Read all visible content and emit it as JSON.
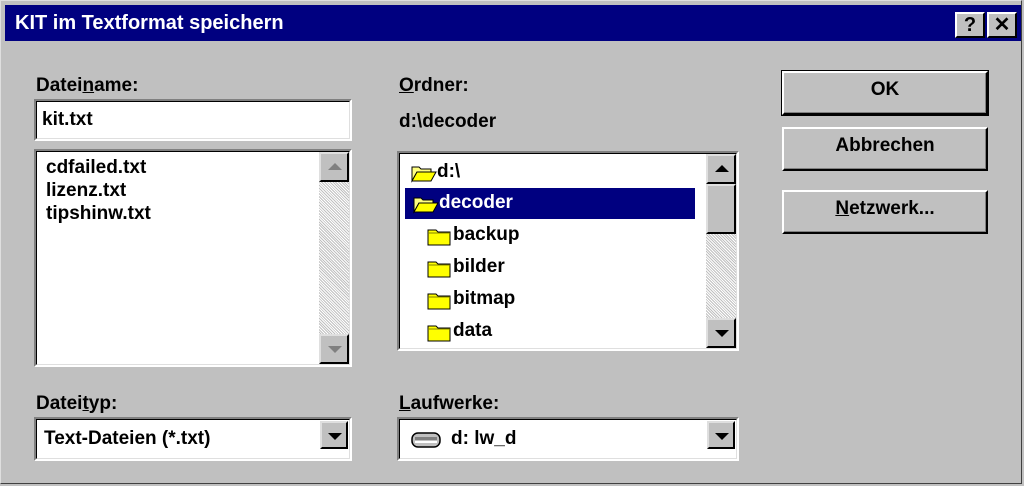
{
  "window": {
    "title": "KIT im Textformat speichern",
    "help_glyph": "?",
    "close_glyph": "✕"
  },
  "filename": {
    "label_pre": "Datei",
    "label_ul": "n",
    "label_post": "ame:",
    "value": "kit.txt",
    "files": [
      "cdfailed.txt",
      "lizenz.txt",
      "tipshinw.txt"
    ]
  },
  "folder": {
    "label_ul": "O",
    "label_post": "rdner:",
    "current_path": "d:\\decoder",
    "items": [
      {
        "name": "d:\\",
        "icon": "open-folder-icon",
        "selected": false
      },
      {
        "name": "decoder",
        "icon": "open-folder-icon",
        "selected": true
      },
      {
        "name": "backup",
        "icon": "folder-icon",
        "selected": false
      },
      {
        "name": "bilder",
        "icon": "folder-icon",
        "selected": false
      },
      {
        "name": "bitmap",
        "icon": "folder-icon",
        "selected": false
      },
      {
        "name": "data",
        "icon": "folder-icon",
        "selected": false
      }
    ]
  },
  "filetype": {
    "label_pre": "Datei",
    "label_ul": "t",
    "label_post": "yp:",
    "value": "Text-Dateien (*.txt)"
  },
  "drives": {
    "label_ul": "L",
    "label_post": "aufwerke:",
    "value": "d: lw_d",
    "icon": "drive-icon"
  },
  "buttons": {
    "ok": "OK",
    "cancel": "Abbrechen",
    "network_ul": "N",
    "network_post": "etzwerk..."
  },
  "colors": {
    "titlebar": "#000080",
    "face": "#c0c0c0",
    "selection": "#000080"
  }
}
